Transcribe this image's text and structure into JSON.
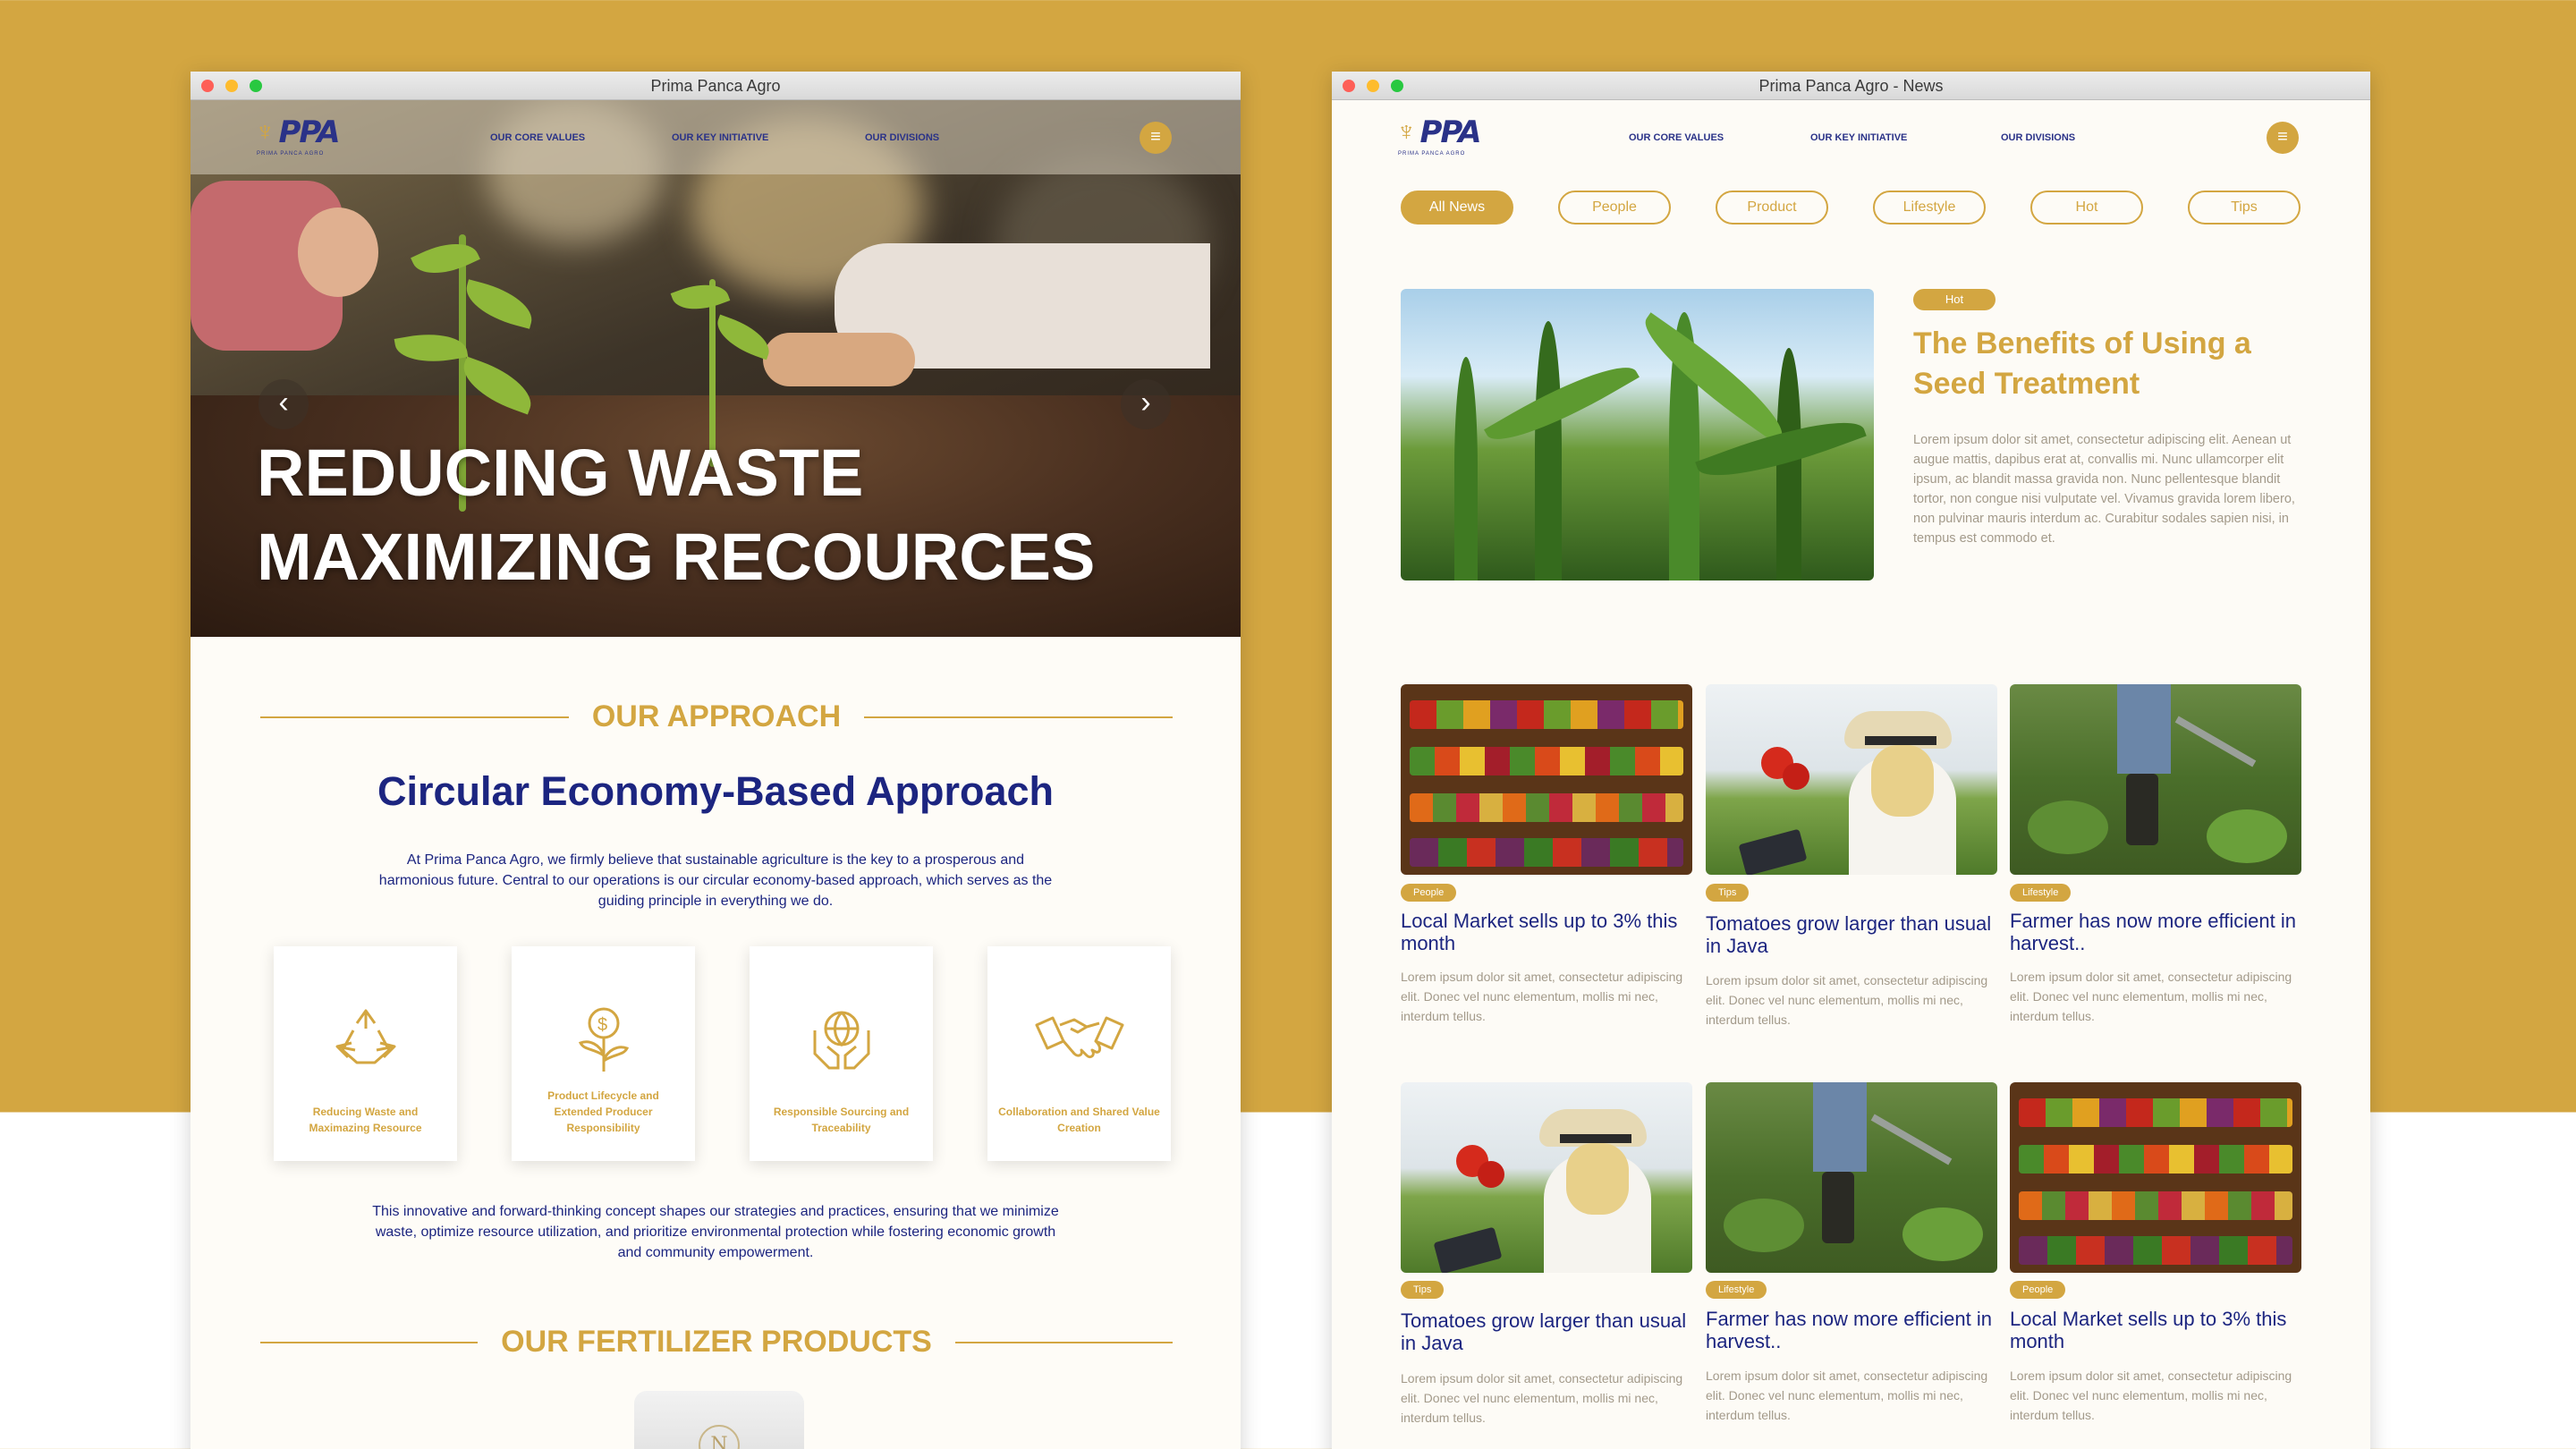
{
  "window1": {
    "title": "Prima Panca Agro",
    "nav": [
      "OUR CORE VALUES",
      "OUR KEY INITIATIVE",
      "OUR DIVISIONS"
    ],
    "logo": {
      "mark": "PPA",
      "tagline": "PRIMA PANCA AGRO"
    },
    "hero": {
      "line1": "REDUCING WASTE",
      "line2": "MAXIMIZING RECOURCES"
    },
    "approach": {
      "section": "OUR APPROACH",
      "title": "Circular Economy-Based Approach",
      "intro": "At Prima Panca Agro, we firmly believe that sustainable agriculture is the key to a prosperous and harmonious future. Central to our operations is our circular economy-based approach, which serves as the guiding principle in everything we do.",
      "cards": [
        {
          "label": "Reducing Waste and Maximazing Resource",
          "icon": "recycle-icon"
        },
        {
          "label": "Product Lifecycle and Extended Producer Responsibility",
          "icon": "money-plant-icon"
        },
        {
          "label": "Responsible Sourcing and Traceability",
          "icon": "globe-hands-icon"
        },
        {
          "label": "Collaboration and Shared Value Creation",
          "icon": "handshake-icon"
        }
      ],
      "outro": "This innovative and forward-thinking concept shapes our strategies and practices, ensuring that we minimize waste, optimize resource utilization, and prioritize environmental protection while fostering economic growth and community empowerment."
    },
    "products": {
      "section": "OUR FERTILIZER PRODUCTS",
      "pack_mark": "N"
    }
  },
  "window2": {
    "title": "Prima Panca Agro - News",
    "nav": [
      "OUR CORE VALUES",
      "OUR KEY INITIATIVE",
      "OUR DIVISIONS"
    ],
    "logo": {
      "mark": "PPA",
      "tagline": "PRIMA PANCA AGRO"
    },
    "filters": [
      "All News",
      "People",
      "Product",
      "Lifestyle",
      "Hot",
      "Tips"
    ],
    "featured": {
      "tag": "Hot",
      "title": "The Benefits of Using a Seed Treatment",
      "body": "Lorem ipsum dolor sit amet, consectetur adipiscing elit. Aenean ut augue mattis, dapibus erat at, convallis mi. Nunc ullamcorper elit ipsum, ac blandit massa gravida non. Nunc pellentesque blandit tortor, non congue nisi vulputate vel. Vivamus gravida lorem libero, non pulvinar mauris interdum ac. Curabitur sodales sapien nisi, in tempus est commodo et."
    },
    "news": [
      {
        "tag": "People",
        "title": "Local Market sells up to 3% this month",
        "body": "Lorem ipsum dolor sit amet, consectetur adipiscing elit. Donec vel nunc elementum, mollis mi nec, interdum tellus."
      },
      {
        "tag": "Tips",
        "title": "Tomatoes grow larger than usual in Java",
        "body": "Lorem ipsum dolor sit amet, consectetur adipiscing elit. Donec vel nunc elementum, mollis mi nec, interdum tellus."
      },
      {
        "tag": "Lifestyle",
        "title": "Farmer has now more efficient in harvest..",
        "body": "Lorem ipsum dolor sit amet, consectetur adipiscing elit. Donec vel nunc elementum, mollis mi nec, interdum tellus."
      },
      {
        "tag": "Tips",
        "title": "Tomatoes grow larger than usual in Java",
        "body": "Lorem ipsum dolor sit amet, consectetur adipiscing elit. Donec vel nunc elementum, mollis mi nec, interdum tellus."
      },
      {
        "tag": "Lifestyle",
        "title": "Farmer has now more efficient in harvest..",
        "body": "Lorem ipsum dolor sit amet, consectetur adipiscing elit. Donec vel nunc elementum, mollis mi nec, interdum tellus."
      },
      {
        "tag": "People",
        "title": "Local Market sells up to 3% this month",
        "body": "Lorem ipsum dolor sit amet, consectetur adipiscing elit. Donec vel nunc elementum, mollis mi nec, interdum tellus."
      }
    ]
  },
  "colors": {
    "brand_gold": "#D3A641",
    "brand_navy": "#1c2580"
  }
}
